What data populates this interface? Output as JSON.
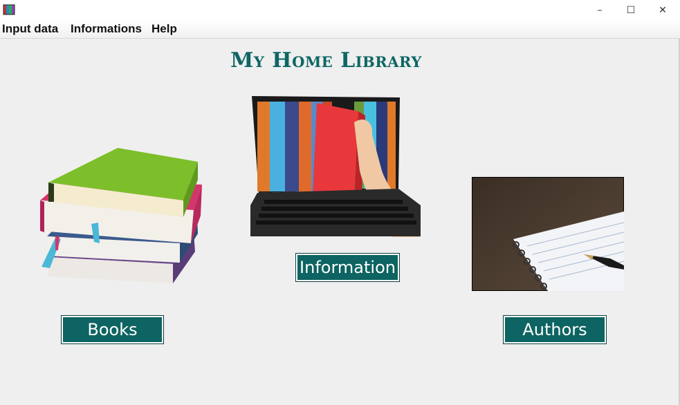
{
  "menubar": {
    "items": [
      "Input data",
      "Informations",
      "Help"
    ]
  },
  "window_controls": {
    "minimize": "–",
    "maximize": "☐",
    "close": "✕"
  },
  "main": {
    "title": "My Home Library",
    "buttons": {
      "books": "Books",
      "information": "Information",
      "authors": "Authors"
    }
  },
  "icons": [
    "app-icon",
    "books-stack-image",
    "laptop-bookshelf-image",
    "notebook-pen-image"
  ],
  "colors": {
    "accent": "#0d6462",
    "title": "#0e6664",
    "background": "#efefef"
  }
}
